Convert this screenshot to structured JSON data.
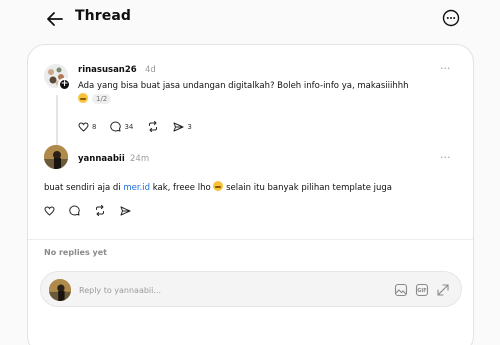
{
  "header": {
    "title": "Thread"
  },
  "post1": {
    "username": "rinasusan26",
    "time": "4d",
    "text": "Ada yang bisa buat jasa undangan digitalkah? Boleh info-info ya, makasiiihhh",
    "page_indicator": "1/2",
    "likes": "8",
    "replies": "34",
    "shares": "3"
  },
  "post2": {
    "username": "yannaabii",
    "time": "24m",
    "text_before": "buat sendiri aja di ",
    "link": "mer.id",
    "text_mid": " kak, freee lho ",
    "text_after": " selain itu banyak pilihan template juga"
  },
  "no_replies": "No replies yet",
  "reply": {
    "placeholder": "Reply to yannaabii..."
  },
  "colors": {
    "link": "#1d6fe0",
    "background": "#fafafa",
    "card": "#ffffff"
  }
}
